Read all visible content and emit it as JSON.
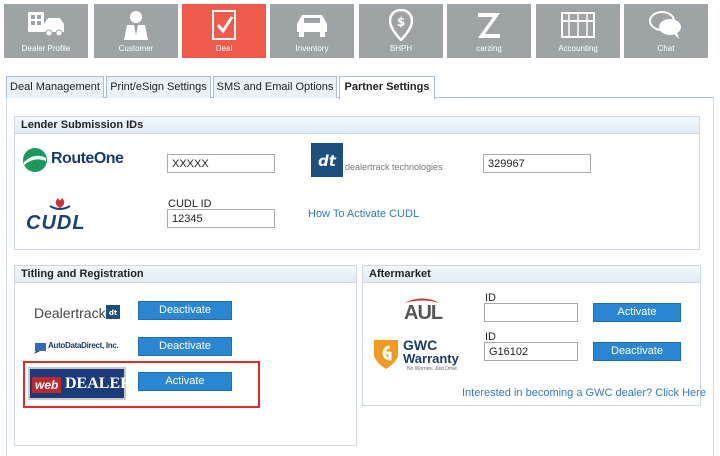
{
  "nav": {
    "items": [
      {
        "label": "Dealer Profile",
        "icon": "dealer-profile-icon"
      },
      {
        "label": "Customer",
        "icon": "customer-icon"
      },
      {
        "label": "Deal",
        "icon": "deal-icon"
      },
      {
        "label": "Inventory",
        "icon": "inventory-icon"
      },
      {
        "label": "BHPH",
        "icon": "bhph-icon"
      },
      {
        "label": "carzing",
        "icon": "carzing-icon"
      },
      {
        "label": "Accounting",
        "icon": "accounting-icon"
      },
      {
        "label": "Chat",
        "icon": "chat-icon"
      }
    ],
    "active": "Deal",
    "active_color": "#ef5a4b",
    "inactive_color": "#9ea3a6"
  },
  "tabs": [
    {
      "label": "Deal Management"
    },
    {
      "label": "Print/eSign Settings"
    },
    {
      "label": "SMS and Email Options"
    },
    {
      "label": "Partner Settings"
    }
  ],
  "active_tab": "Partner Settings",
  "lender": {
    "title": "Lender Submission IDs",
    "routeone": {
      "logo_text": "RouteOne",
      "value": "XXXXX"
    },
    "dealertrack": {
      "logo_text": "dealertrack technologies",
      "value": "329967"
    },
    "cudl": {
      "logo_text": "CUDL",
      "field_label": "CUDL ID",
      "value": "12345",
      "link": "How To Activate CUDL"
    }
  },
  "titling": {
    "title": "Titling and Registration",
    "rows": [
      {
        "logo_text": "Dealertrack",
        "button": "Deactivate"
      },
      {
        "logo_text": "AutoDataDirect, Inc.",
        "button": "Deactivate"
      },
      {
        "logo_text_a": "web",
        "logo_text_b": "DEALER",
        "button": "Activate"
      }
    ]
  },
  "aftermarket": {
    "title": "Aftermarket",
    "aul": {
      "logo_text": "AUL",
      "field_label": "ID",
      "value": "",
      "button": "Activate"
    },
    "gwc": {
      "logo_text_a": "GWC",
      "logo_text_b": "Warranty",
      "tagline": "No Worries. Just Drive.",
      "field_label": "ID",
      "value": "G16102",
      "button": "Deactivate"
    },
    "link": "Interested in becoming a GWC dealer? Click Here"
  },
  "colors": {
    "button_blue": "#2a86d0",
    "highlight_red": "#e02b2b",
    "link_blue": "#2f7abf"
  }
}
